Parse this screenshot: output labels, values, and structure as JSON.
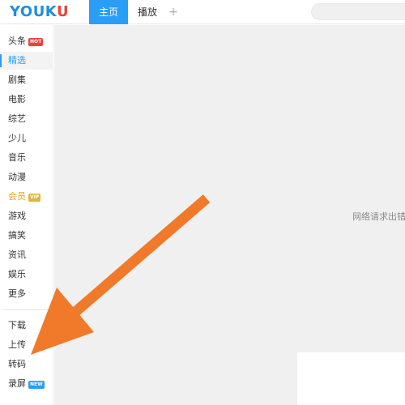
{
  "app": {
    "logo_text": "YOUKU",
    "logo_colors": {
      "blue": "#1f8fe0",
      "red": "#e8443a"
    },
    "accent_color": "#2a9df4"
  },
  "tabs": [
    {
      "label": "主页",
      "active": true
    },
    {
      "label": "播放",
      "active": false
    },
    {
      "label": "+",
      "active": false
    }
  ],
  "search": {
    "placeholder": ""
  },
  "sidebar": {
    "items": [
      {
        "label": "头条",
        "badge": "HOT"
      },
      {
        "label": "精选",
        "active": true
      },
      {
        "label": "剧集"
      },
      {
        "label": "电影"
      },
      {
        "label": "综艺"
      },
      {
        "label": "少儿"
      },
      {
        "label": "音乐"
      },
      {
        "label": "动漫"
      },
      {
        "label": "会员",
        "badge": "VIP"
      },
      {
        "label": "游戏"
      },
      {
        "label": "搞笑"
      },
      {
        "label": "资讯"
      },
      {
        "label": "娱乐"
      },
      {
        "label": "更多"
      },
      {
        "label": "下载"
      },
      {
        "label": "上传"
      },
      {
        "label": "转码"
      },
      {
        "label": "录屏",
        "badge": "NEW"
      }
    ]
  },
  "main": {
    "error_text": "网络请求出错哦"
  },
  "annotation": {
    "arrow_color": "#f07a2a",
    "points_to": "转码"
  }
}
